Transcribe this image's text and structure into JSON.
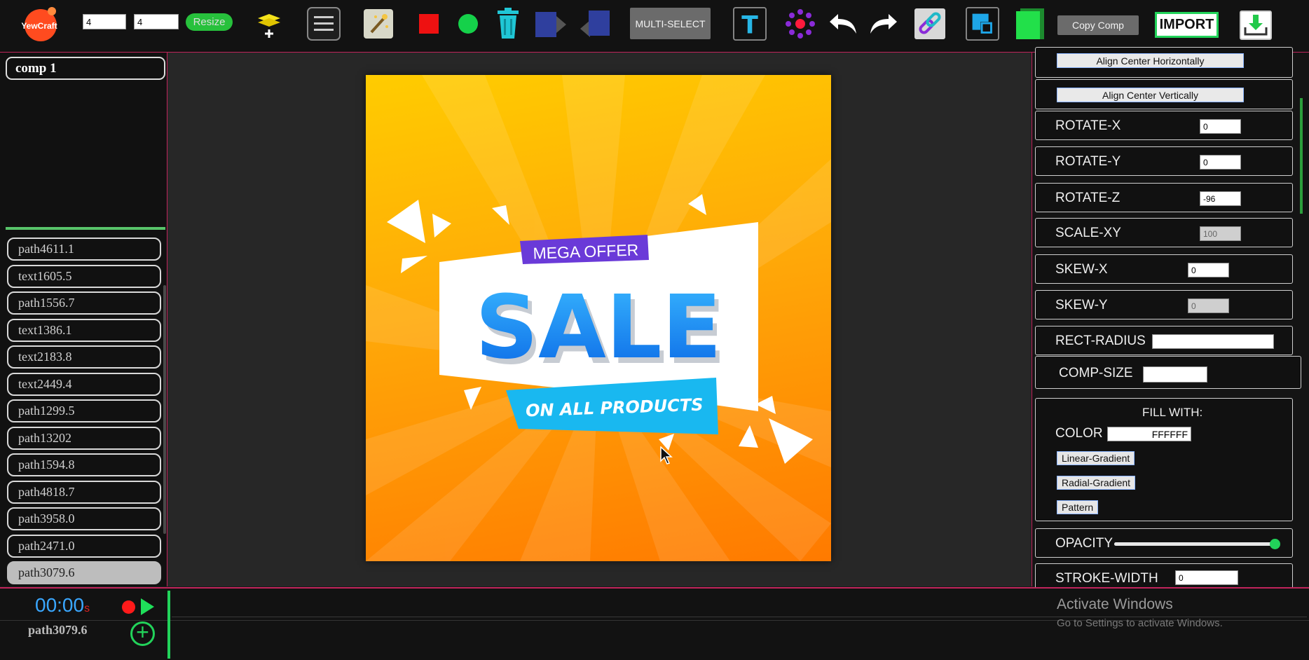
{
  "app": {
    "logo_text": "YewCraft"
  },
  "toolbar": {
    "width_value": "4",
    "height_value": "4",
    "resize_label": "Resize",
    "multiselect_label": "MULTI-SELECT",
    "copy_comp_label": "Copy Comp",
    "import_label": "IMPORT",
    "text_tool_glyph": "T"
  },
  "comp_tab": "comp 1",
  "layers": [
    "path4611.1",
    "text1605.5",
    "path1556.7",
    "text1386.1",
    "text2183.8",
    "text2449.4",
    "path1299.5",
    "path13202",
    "path1594.8",
    "path4818.7",
    "path3958.0",
    "path2471.0",
    "path3079.6"
  ],
  "selected_layer_index": 12,
  "artboard": {
    "mega_offer": "MEGA OFFER",
    "sale": "SALE",
    "on_all_products": "ON ALL PRODUCTS"
  },
  "properties": {
    "align_center_horizontally": "Align Center Horizontally",
    "align_center_vertically": "Align Center Vertically",
    "rotate_x": {
      "label": "ROTATE-X",
      "value": "0"
    },
    "rotate_y": {
      "label": "ROTATE-Y",
      "value": "0"
    },
    "rotate_z": {
      "label": "ROTATE-Z",
      "value": "-96"
    },
    "scale_xy": {
      "label": "SCALE-XY",
      "value": "100"
    },
    "skew_x": {
      "label": "SKEW-X",
      "value": "0"
    },
    "skew_y": {
      "label": "SKEW-Y",
      "value": "0"
    },
    "rect_radius": {
      "label": "RECT-RADIUS",
      "value": ""
    },
    "comp_size": {
      "label": "COMP-SIZE",
      "value": ""
    },
    "fill": {
      "title": "FILL WITH:",
      "color_label": "COLOR",
      "color_value": "FFFFFF",
      "linear_gradient": "Linear-Gradient",
      "radial_gradient": "Radial-Gradient",
      "pattern": "Pattern"
    },
    "opacity": {
      "label": "OPACITY",
      "level": 1.0
    },
    "stroke_width": {
      "label": "STROKE-WIDTH",
      "value": "0"
    }
  },
  "timeline": {
    "time": "00:00",
    "time_suffix": "s",
    "layer_name": "path3079.6"
  },
  "watermark": {
    "title": "Activate Windows",
    "subtitle": "Go to Settings to activate Windows."
  },
  "colors": {
    "accent_border": "#c0245b",
    "green": "#22d35a",
    "sale_blue": "#1a8cff",
    "banner_cyan": "#19b8f0",
    "mega_purple": "#6a3ad8"
  }
}
